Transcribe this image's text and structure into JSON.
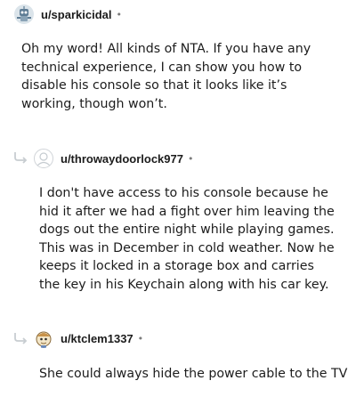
{
  "comments": [
    {
      "username": "u/sparkicidal",
      "separator": "•",
      "avatar_icon": "robot-avatar-icon",
      "body": "Oh my word! All kinds of NTA. If you have any technical experience, I can show you how to disable his console so that it looks like it’s working, though won’t."
    },
    {
      "username": "u/throwaydoorlock977",
      "separator": "•",
      "avatar_icon": "default-avatar-icon",
      "body": "I don't have access to his console because he hid it after we had a fight over him leaving the dogs out the entire night while playing games. This was in December in cold weather. Now he keeps it locked in a storage box and carries the key in his Keychain along with his car key."
    },
    {
      "username": "u/ktclem1337",
      "separator": "•",
      "avatar_icon": "character-avatar-icon",
      "body": "She could always hide the power cable to the TV"
    }
  ],
  "colors": {
    "text": "#1c1c1c",
    "meta": "#7c7c7c",
    "thread_line": "#c8cdd1"
  }
}
